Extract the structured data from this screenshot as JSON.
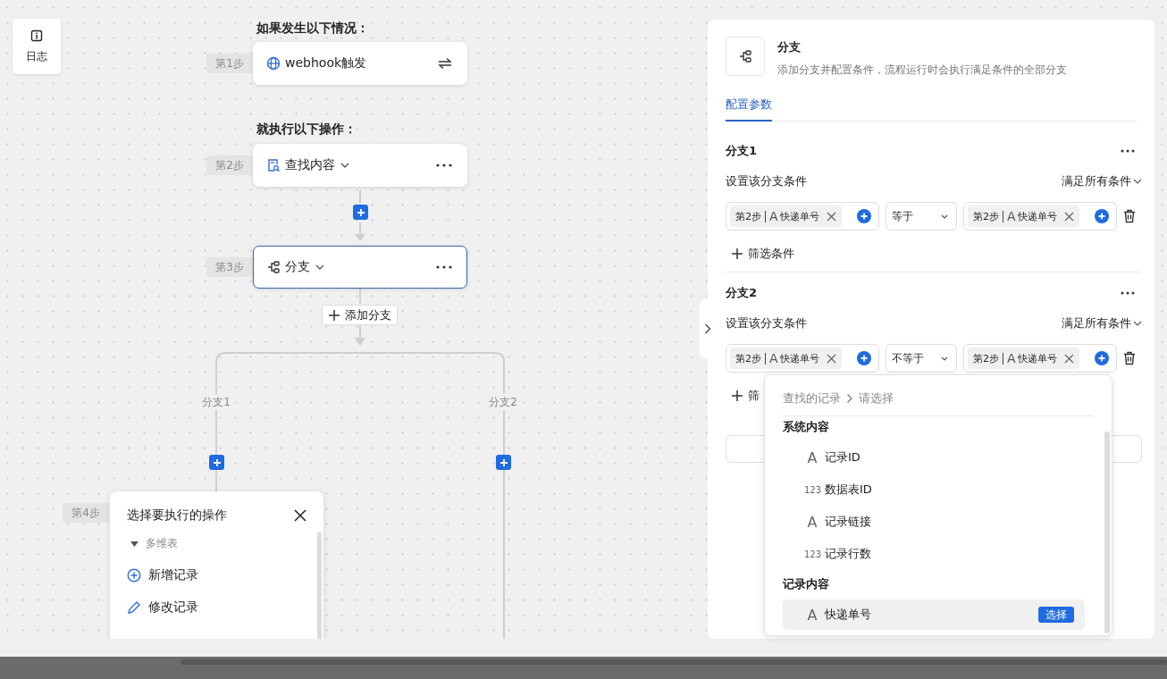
{
  "log_button": {
    "label": "日志"
  },
  "flow": {
    "trigger_heading": "如果发生以下情况：",
    "action_heading": "就执行以下操作：",
    "steps": [
      {
        "step": "第1步",
        "kind": "trigger",
        "title": "webhook触发",
        "selected": false
      },
      {
        "step": "第2步",
        "kind": "action",
        "title": "查找内容",
        "selected": false
      },
      {
        "step": "第3步",
        "kind": "branch",
        "title": "分支",
        "selected": true
      }
    ],
    "add_branch": "添加分支",
    "branches": [
      {
        "label": "分支1"
      },
      {
        "label": "分支2"
      }
    ],
    "next_step": "第4步",
    "action_picker": {
      "title": "选择要执行的操作",
      "group": {
        "label": "多维表",
        "expanded": true
      },
      "items": [
        {
          "label": "新增记录",
          "kind": "add"
        },
        {
          "label": "修改记录",
          "kind": "edit"
        }
      ]
    }
  },
  "panel": {
    "title": "分支",
    "description": "添加分支并配置条件，流程运行时会执行满足条件的全部分支",
    "tabs": [
      {
        "label": "配置参数",
        "selected": true
      }
    ],
    "branches": [
      {
        "name": "分支1",
        "condition_label": "设置该分支条件",
        "match_mode": "满足所有条件",
        "left": {
          "step": "第2步",
          "type": "A",
          "field": "快递单号"
        },
        "operator": "等于",
        "right": {
          "step": "第2步",
          "type": "A",
          "field": "快递单号"
        },
        "add_filter": "筛选条件"
      },
      {
        "name": "分支2",
        "condition_label": "设置该分支条件",
        "match_mode": "满足所有条件",
        "left": {
          "step": "第2步",
          "type": "A",
          "field": "快递单号"
        },
        "operator": "不等于",
        "right": {
          "step": "第2步",
          "type": "A",
          "field": "快递单号"
        },
        "add_filter": "筛"
      }
    ],
    "field_picker": {
      "breadcrumb": [
        "查找的记录",
        "请选择"
      ],
      "sections": [
        {
          "title": "系统内容",
          "items": [
            {
              "type": "A",
              "label": "记录ID",
              "selected": false
            },
            {
              "type": "123",
              "label": "数据表ID",
              "selected": false
            },
            {
              "type": "A",
              "label": "记录链接",
              "selected": false
            },
            {
              "type": "123",
              "label": "记录行数",
              "selected": false
            }
          ]
        },
        {
          "title": "记录内容",
          "items": [
            {
              "type": "A",
              "label": "快递单号",
              "selected": true,
              "action": "选择"
            }
          ]
        }
      ]
    }
  }
}
